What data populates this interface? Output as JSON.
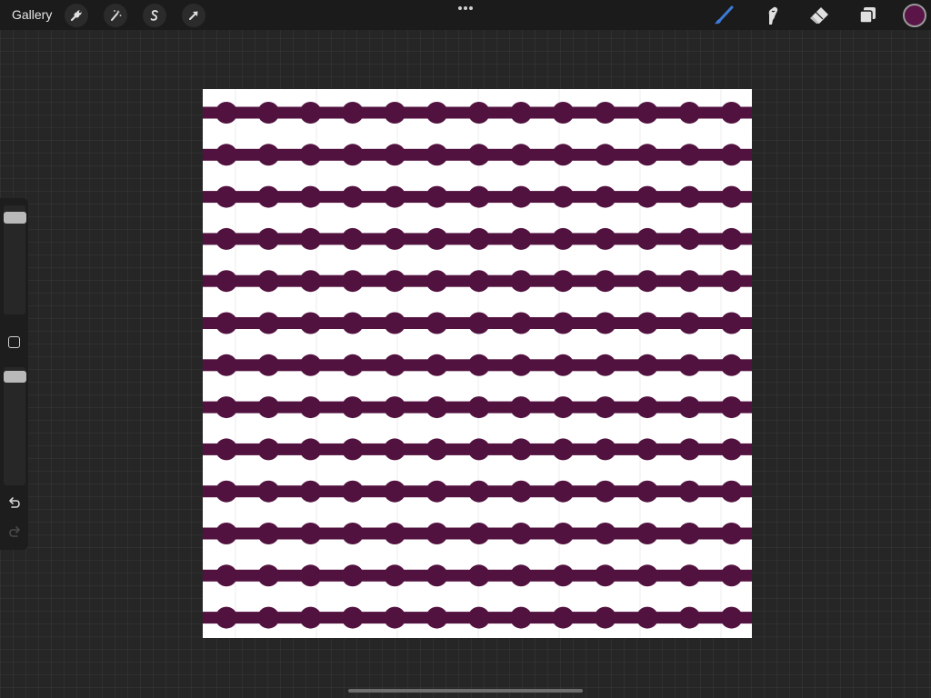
{
  "toolbar": {
    "gallery_label": "Gallery",
    "left_tools": [
      {
        "name": "actions",
        "icon": "wrench-icon"
      },
      {
        "name": "adjustments",
        "icon": "magic-wand-icon"
      },
      {
        "name": "selection",
        "icon": "selection-s-icon"
      },
      {
        "name": "transform",
        "icon": "arrow-cursor-icon"
      }
    ],
    "more_icon": "more-dots-icon",
    "right_tools": [
      {
        "name": "brush",
        "icon": "brush-icon",
        "active": true
      },
      {
        "name": "smudge",
        "icon": "smudge-finger-icon",
        "active": false
      },
      {
        "name": "eraser",
        "icon": "eraser-icon",
        "active": false
      },
      {
        "name": "layers",
        "icon": "layers-icon",
        "active": false
      }
    ],
    "active_color": "#5a1447"
  },
  "sidebar": {
    "size_slider_icon": "brush-size-slider",
    "modify_icon": "square-modify-icon",
    "opacity_slider_icon": "brush-opacity-slider",
    "undo_icon": "undo-arrow-icon",
    "redo_icon": "redo-arrow-icon",
    "redo_enabled": false
  },
  "canvas": {
    "background": "#ffffff",
    "stroke_color": "#52123f",
    "line_count": 13,
    "dots_per_line": 13
  },
  "colors": {
    "accent_blue": "#3d7bd9",
    "ui_bg": "#262626",
    "bar_bg": "#1b1b1b"
  }
}
